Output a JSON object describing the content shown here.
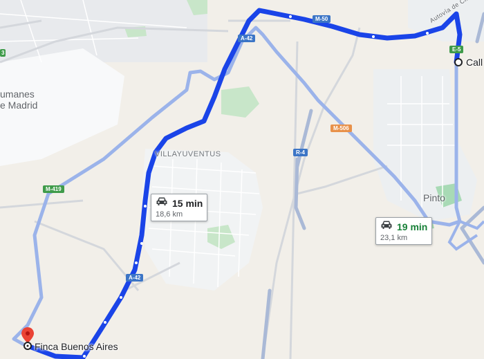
{
  "places": {
    "humanes": "umanes\ne Madrid",
    "villayuventus": "VILLAYUVENTUS",
    "pinto": "Pinto"
  },
  "roads": {
    "a42_top": "A-42",
    "a42_bottom": "A-42",
    "m50": "M-50",
    "m506": "M-506",
    "r4": "R-4",
    "m419": "M-419",
    "e5": "E-5",
    "autovia": "Autovía de Circ.",
    "left_edge": "3"
  },
  "routes": {
    "primary": {
      "time": "15 min",
      "distance": "18,6 km"
    },
    "alternate": {
      "time": "19 min",
      "distance": "23,1 km"
    }
  },
  "endpoints": {
    "destination": "Finca Buenos Aires",
    "origin": "Call"
  },
  "colors": {
    "primary_route": "#1a44e8",
    "alternate_route": "#9bb3ea",
    "marker": "#ea4335",
    "alt_time": "#188038"
  }
}
